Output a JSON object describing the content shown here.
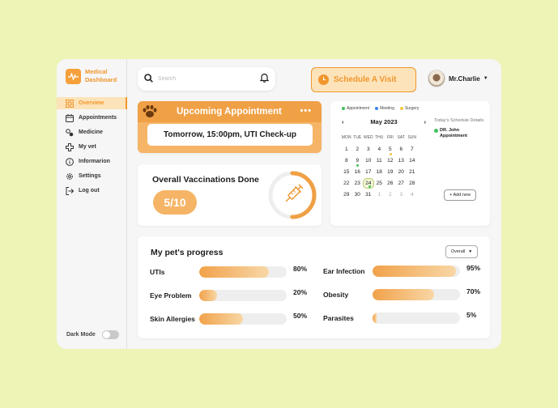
{
  "brand": {
    "name": "Medical Dashboard"
  },
  "sidebar": {
    "items": [
      {
        "label": "Overview",
        "icon": "grid-icon",
        "active": true
      },
      {
        "label": "Appointments",
        "icon": "calendar-icon",
        "active": false
      },
      {
        "label": "Medicine",
        "icon": "pills-icon",
        "active": false
      },
      {
        "label": "My vet",
        "icon": "medical-cross-icon",
        "active": false
      },
      {
        "label": "Informarion",
        "icon": "info-icon",
        "active": false
      },
      {
        "label": "Settings",
        "icon": "gear-icon",
        "active": false
      },
      {
        "label": "Log out",
        "icon": "logout-icon",
        "active": false
      }
    ],
    "dark_mode_label": "Dark Mode"
  },
  "header": {
    "search_placeholder": "Search",
    "schedule_button": "Schedule A Visit",
    "user_name": "Mr.Charlie"
  },
  "appointment": {
    "title": "Upcoming Appointment",
    "more": "•••",
    "detail": "Tomorrow, 15:00pm, UTI Check-up"
  },
  "vaccinations": {
    "title": "Overall Vaccinations Done",
    "value_text": "5/10",
    "done": 5,
    "total": 10
  },
  "calendar": {
    "legend": [
      {
        "label": "Appointment",
        "color": "#3fc25b"
      },
      {
        "label": "Meeting",
        "color": "#3b82f6"
      },
      {
        "label": "Surgery",
        "color": "#f5c542"
      }
    ],
    "month": "May 2023",
    "weekdays": [
      "MON",
      "TUE",
      "WED",
      "THU",
      "FRI",
      "SAT",
      "SUN"
    ],
    "weeks": [
      [
        "1",
        "2",
        "3",
        "4",
        "5",
        "6",
        "7"
      ],
      [
        "8",
        "9",
        "10",
        "11",
        "12",
        "13",
        "14"
      ],
      [
        "15",
        "16",
        "17",
        "18",
        "19",
        "20",
        "21"
      ],
      [
        "22",
        "23",
        "24",
        "25",
        "26",
        "27",
        "28"
      ],
      [
        "29",
        "30",
        "31",
        "1",
        "2",
        "3",
        "4"
      ]
    ],
    "schedule_title": "Today's Schedule Details",
    "schedule_item": "DR. John Appointment",
    "add_new": "+ Add new"
  },
  "progress": {
    "title": "My pet's progress",
    "filter": "Overall",
    "left": [
      {
        "label": "UTIs",
        "percent": 80,
        "text": "80%"
      },
      {
        "label": "Eye Problem",
        "percent": 20,
        "text": "20%"
      },
      {
        "label": "Skin Allergies",
        "percent": 50,
        "text": "50%"
      }
    ],
    "right": [
      {
        "label": "Ear Infection",
        "percent": 95,
        "text": "95%"
      },
      {
        "label": "Obesity",
        "percent": 70,
        "text": "70%"
      },
      {
        "label": "Parasites",
        "percent": 5,
        "text": "5%"
      }
    ]
  },
  "colors": {
    "accent": "#f0962d",
    "accent_light": "#fde3b9",
    "background": "#eef3b6"
  }
}
